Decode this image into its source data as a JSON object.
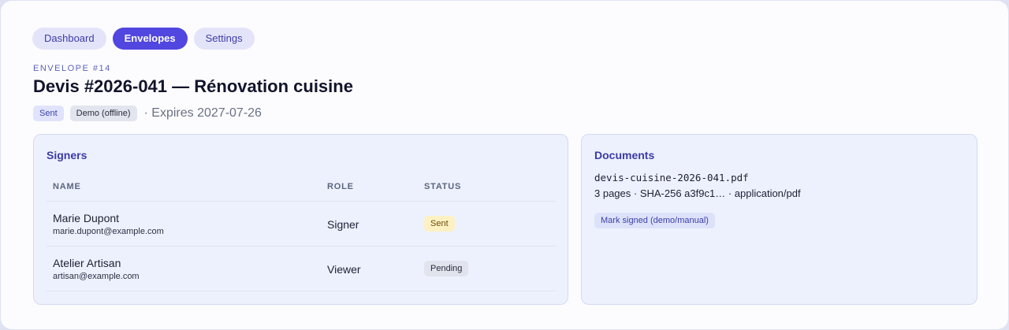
{
  "nav": {
    "items": [
      {
        "label": "Dashboard",
        "active": false
      },
      {
        "label": "Envelopes",
        "active": true
      },
      {
        "label": "Settings",
        "active": false
      }
    ]
  },
  "header": {
    "eyebrow": "ENVELOPE #14",
    "title": "Devis #2026-041 — Rénovation cuisine",
    "badges": [
      "Sent",
      "Demo (offline)"
    ],
    "expires": "· Expires 2027-07-26"
  },
  "signers": {
    "title": "Signers",
    "columns": [
      "NAME",
      "ROLE",
      "STATUS"
    ],
    "rows": [
      {
        "name": "Marie Dupont",
        "email": "marie.dupont@example.com",
        "role": "Signer",
        "status": "Sent"
      },
      {
        "name": "Atelier Artisan",
        "email": "artisan@example.com",
        "role": "Viewer",
        "status": "Pending"
      }
    ]
  },
  "documents": {
    "title": "Documents",
    "file_name": "devis-cuisine-2026-041.pdf",
    "file_meta": "3 pages · SHA-256 a3f9c1… · application/pdf",
    "mark_signed_label": "Mark signed (demo/manual)"
  },
  "colors": {
    "accent": "#5146e0",
    "status_sent_bg": "#fdf1c4",
    "status_pending_bg": "#e1e4ec",
    "card_bg": "#edf1fd"
  }
}
